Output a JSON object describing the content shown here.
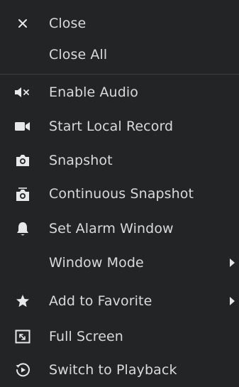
{
  "context_menu": {
    "items": [
      {
        "label": "Close",
        "icon": "close-icon"
      },
      {
        "label": "Close All",
        "icon": ""
      },
      {
        "label": "Enable Audio",
        "icon": "speaker-muted-icon"
      },
      {
        "label": "Start Local Record",
        "icon": "video-camera-icon"
      },
      {
        "label": "Snapshot",
        "icon": "camera-icon"
      },
      {
        "label": "Continuous Snapshot",
        "icon": "burst-camera-icon"
      },
      {
        "label": "Set Alarm Window",
        "icon": "bell-icon"
      },
      {
        "label": "Window Mode",
        "icon": "",
        "submenu": true
      },
      {
        "label": "Add to Favorite",
        "icon": "star-icon",
        "submenu": true
      },
      {
        "label": "Full Screen",
        "icon": "fullscreen-icon"
      },
      {
        "label": "Switch to Playback",
        "icon": "playback-icon"
      }
    ]
  },
  "colors": {
    "background": "#222426",
    "text": "#dadada",
    "icon": "#e8e8e8",
    "divider": "#3a3d40"
  }
}
